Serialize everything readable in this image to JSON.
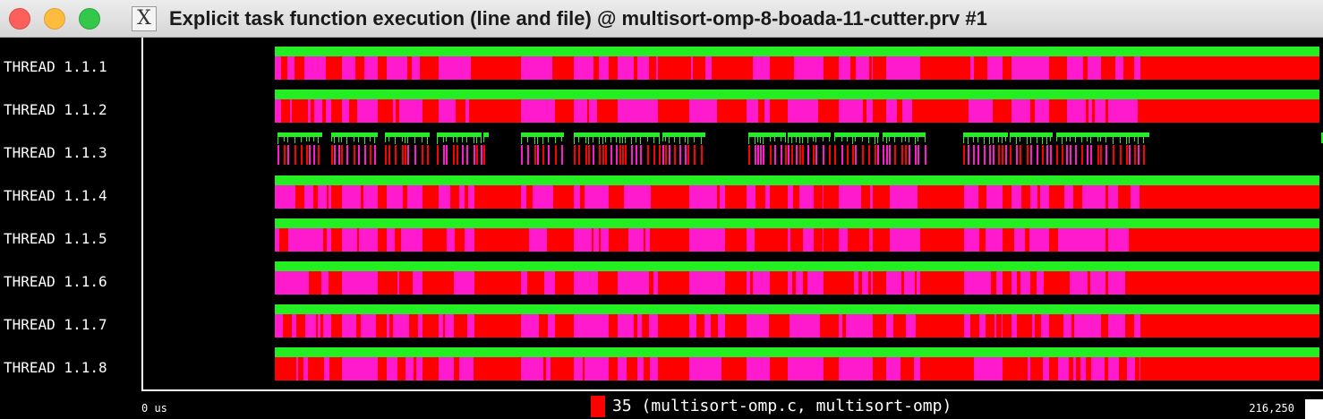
{
  "window": {
    "title": "Explicit task function execution (line and file) @ multisort-omp-8-boada-11-cutter.prv #1",
    "app_icon": "x11-icon"
  },
  "threads": [
    {
      "label": "THREAD 1.1.1"
    },
    {
      "label": "THREAD 1.1.2"
    },
    {
      "label": "THREAD 1.1.3"
    },
    {
      "label": "THREAD 1.1.4"
    },
    {
      "label": "THREAD 1.1.5"
    },
    {
      "label": "THREAD 1.1.6"
    },
    {
      "label": "THREAD 1.1.7"
    },
    {
      "label": "THREAD 1.1.8"
    }
  ],
  "axis": {
    "start_label": "0 us",
    "end_label": "216,250"
  },
  "legend": {
    "label": "35 (multisort-omp.c, multisort-omp)",
    "color": "#ff0000"
  },
  "colors": {
    "green": "#22ee22",
    "red": "#ff0000",
    "magenta": "#ff1acd",
    "background": "#000000"
  }
}
